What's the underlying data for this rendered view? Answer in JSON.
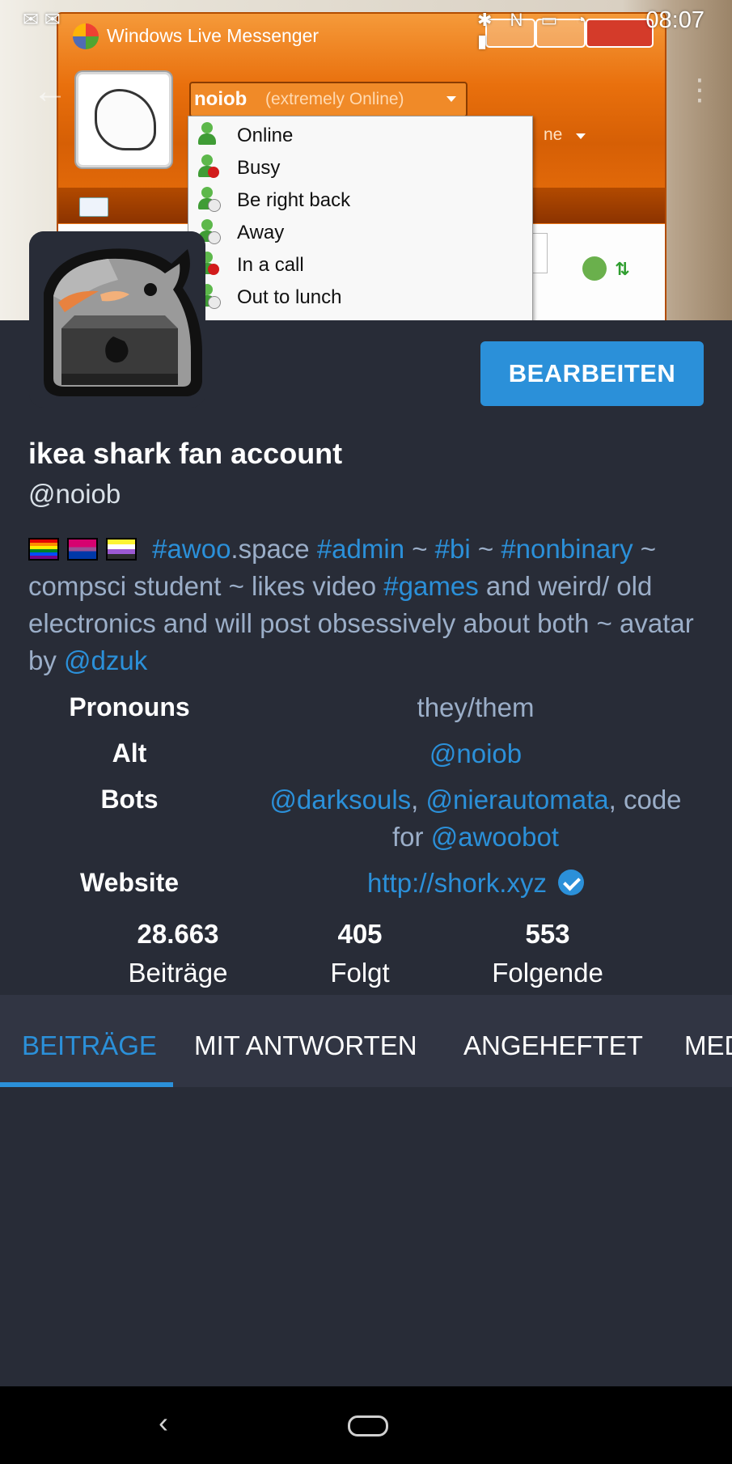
{
  "status_bar": {
    "time": "08:07"
  },
  "header_image": {
    "window_title": "Windows Live Messenger",
    "status_name": "noiob",
    "status_text": "(extremely Online)",
    "secondary_text": "ne",
    "status_menu": [
      {
        "label": "Online",
        "badge": "none"
      },
      {
        "label": "Busy",
        "badge": "busy"
      },
      {
        "label": "Be right back",
        "badge": "clock"
      },
      {
        "label": "Away",
        "badge": "clock"
      },
      {
        "label": "In a call",
        "badge": "busy"
      },
      {
        "label": "Out to lunch",
        "badge": "clock"
      }
    ]
  },
  "profile": {
    "edit_button": "BEARBEITEN",
    "display_name": "ikea shark fan account",
    "handle": "@noiob",
    "bio": {
      "tag_awoo": "#awoo",
      "text_space": ".space ",
      "tag_admin": "#admin",
      "sep1": " ~ ",
      "tag_bi": "#bi",
      "sep2": " ~ ",
      "tag_nonbinary": "#nonbinary",
      "text_mid": " ~ compsci student ~ likes video ",
      "tag_games": "#games",
      "text_end": " and weird/ old electronics and will post obsessively about both ~ avatar by ",
      "mention_dzuk": "@dzuk"
    },
    "fields": {
      "pronouns": {
        "name": "Pronouns",
        "value": "they/them"
      },
      "alt": {
        "name": "Alt",
        "value": "@noiob"
      },
      "bots": {
        "name": "Bots",
        "link1": "@darksouls",
        "sep": ", ",
        "link2": "@nierautomata",
        "text": ", code for ",
        "link3": "@awoobot"
      },
      "website": {
        "name": "Website",
        "value": "http://shork.xyz"
      }
    },
    "stats": {
      "posts": {
        "value": "28.663",
        "label": "Beiträge"
      },
      "following": {
        "value": "405",
        "label": "Folgt"
      },
      "followers": {
        "value": "553",
        "label": "Folgende"
      }
    }
  },
  "tabs": [
    "BEITRÄGE",
    "MIT ANTWORTEN",
    "ANGEHEFTET",
    "MEDIEN"
  ],
  "colors": {
    "accent": "#2b90d9",
    "background": "#282c37",
    "tab_bar": "#313543",
    "secondary_text": "#9baec8"
  }
}
